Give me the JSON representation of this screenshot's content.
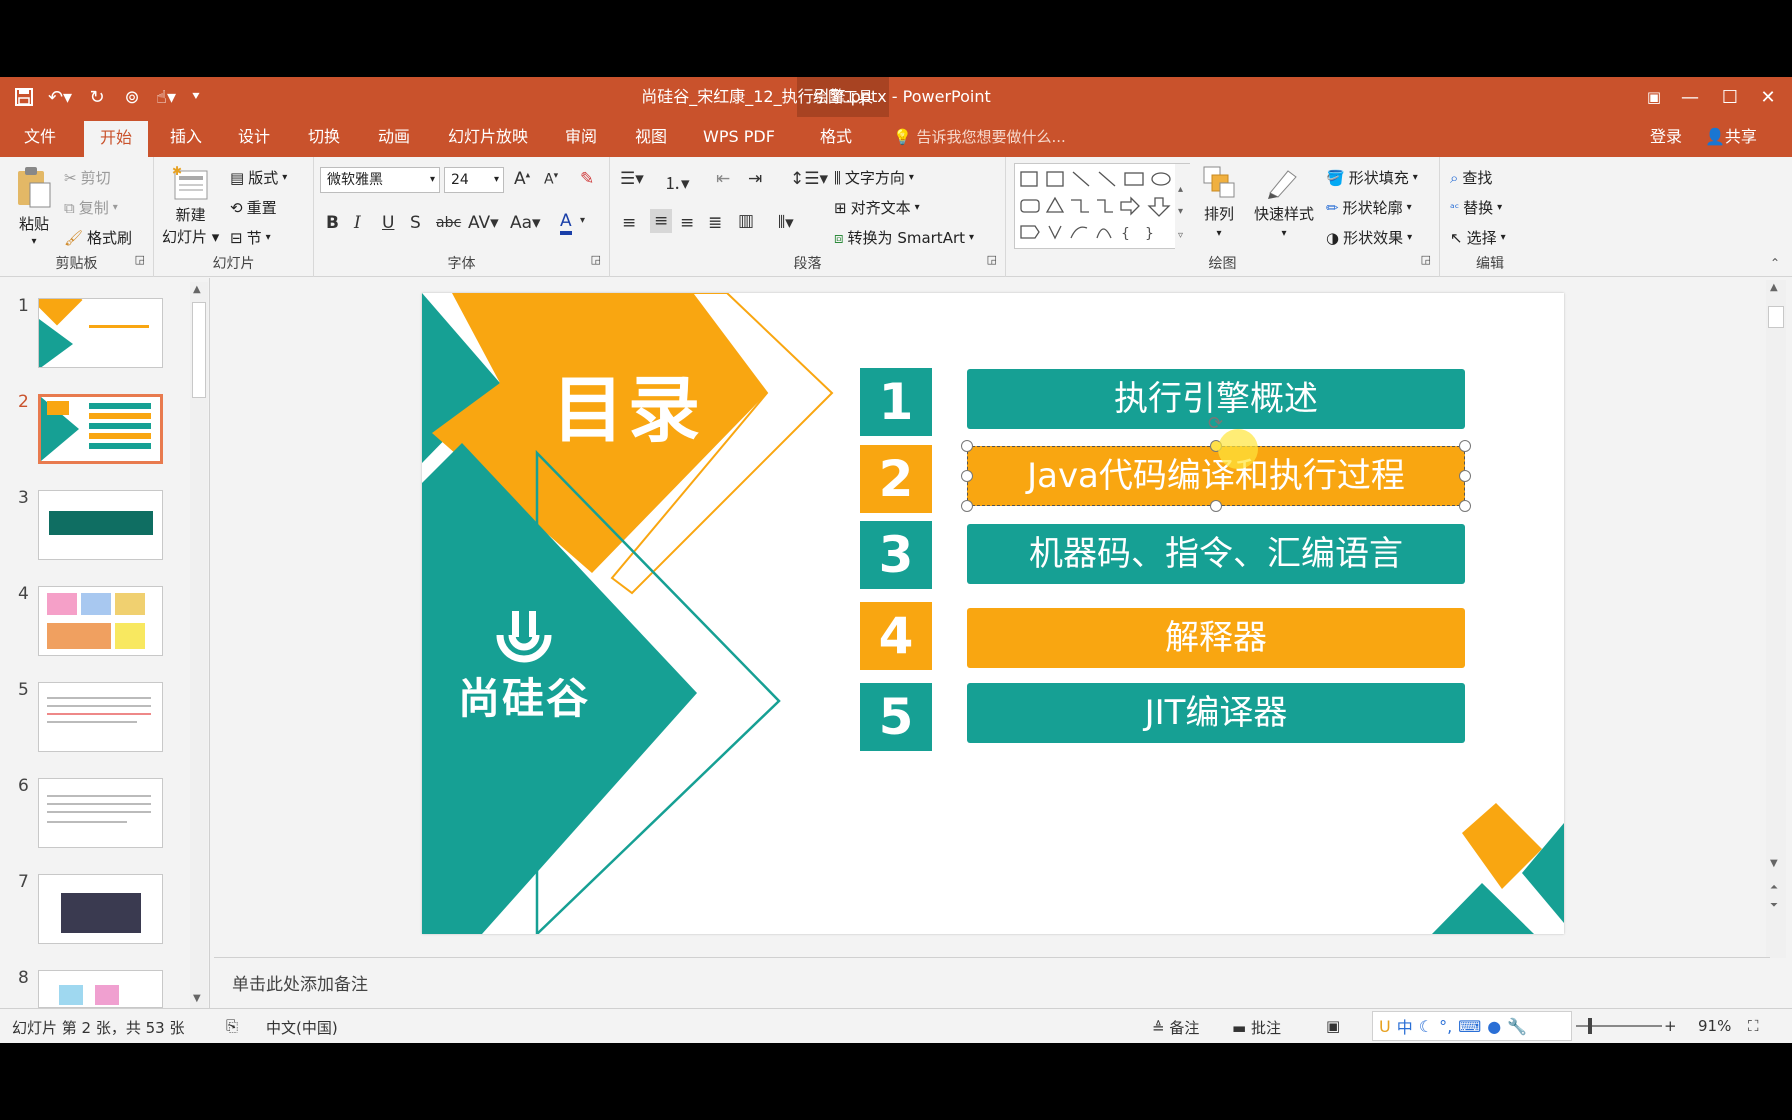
{
  "window": {
    "title": "尚硅谷_宋红康_12_执行引擎.pptx - PowerPoint",
    "context_tool": "绘图工具"
  },
  "tabs": [
    "文件",
    "开始",
    "插入",
    "设计",
    "切换",
    "动画",
    "幻灯片放映",
    "审阅",
    "视图",
    "WPS PDF",
    "格式"
  ],
  "tell_me": "告诉我您想要做什么...",
  "account": {
    "login": "登录",
    "share": "共享"
  },
  "ribbon": {
    "clipboard": {
      "paste": "粘贴",
      "cut": "剪切",
      "copy": "复制",
      "format_painter": "格式刷",
      "label": "剪贴板"
    },
    "slides": {
      "new_slide": "新建\n幻灯片",
      "new_slide_l1": "新建",
      "new_slide_l2": "幻灯片",
      "layout": "版式",
      "reset": "重置",
      "section": "节",
      "label": "幻灯片"
    },
    "font": {
      "name": "微软雅黑",
      "size": "24",
      "label": "字体"
    },
    "paragraph": {
      "text_direction": "文字方向",
      "align_text": "对齐文本",
      "convert_smartart": "转换为 SmartArt",
      "label": "段落"
    },
    "drawing": {
      "arrange": "排列",
      "quick_styles": "快速样式",
      "shape_fill": "形状填充",
      "shape_outline": "形状轮廓",
      "shape_effects": "形状效果",
      "label": "绘图"
    },
    "editing": {
      "find": "查找",
      "replace": "替换",
      "select": "选择",
      "label": "编辑"
    }
  },
  "thumbnails": {
    "numbers": [
      "1",
      "2",
      "3",
      "4",
      "5",
      "6",
      "7",
      "8"
    ],
    "selected": 2
  },
  "slide": {
    "heading": "目录",
    "brand": "尚硅谷",
    "items": [
      {
        "num": "1",
        "text": "执行引擎概述",
        "color": "#16a094"
      },
      {
        "num": "2",
        "text": "Java代码编译和执行过程",
        "color": "#f9a611"
      },
      {
        "num": "3",
        "text": "机器码、指令、汇编语言",
        "color": "#16a094"
      },
      {
        "num": "4",
        "text": "解释器",
        "color": "#f9a611"
      },
      {
        "num": "5",
        "text": "JIT编译器",
        "color": "#16a094"
      }
    ]
  },
  "notes_placeholder": "单击此处添加备注",
  "status": {
    "slide_counter": "幻灯片 第 2 张，共 53 张",
    "language": "中文(中国)",
    "notes": "备注",
    "comments": "批注",
    "zoom": "91%"
  },
  "colors": {
    "accent": "#c9522c",
    "teal": "#16a094",
    "orange": "#f9a611"
  }
}
